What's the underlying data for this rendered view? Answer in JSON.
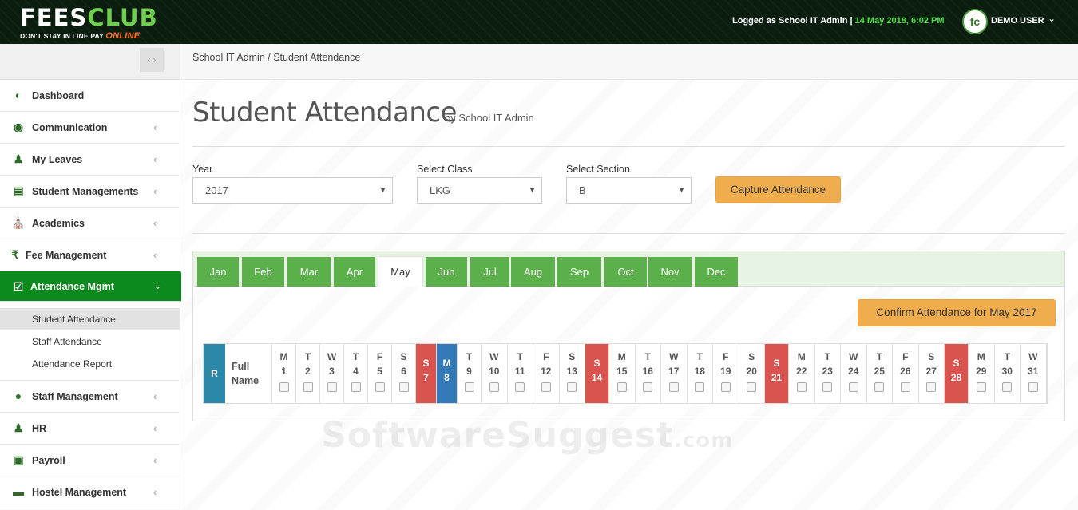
{
  "header": {
    "logo_fees": "FEES",
    "logo_club": "CLUB",
    "tagline": "DON'T STAY IN LINE PAY",
    "tagline_online": "ONLINE",
    "logged_as": "Logged as School IT Admin |",
    "datetime": "14 May 2018, 6:02 PM",
    "avatar_initials": "fc",
    "user_name": "DEMO USER"
  },
  "sidebar": {
    "items": [
      {
        "label": "Dashboard",
        "icon": "dashboard-icon"
      },
      {
        "label": "Communication",
        "icon": "comments-icon"
      },
      {
        "label": "My Leaves",
        "icon": "user-tree-icon"
      },
      {
        "label": "Student Managements",
        "icon": "id-card-icon"
      },
      {
        "label": "Academics",
        "icon": "institution-icon"
      },
      {
        "label": "Fee Management",
        "icon": "rupee-icon"
      },
      {
        "label": "Attendance Mgmt",
        "icon": "check-square-icon"
      },
      {
        "label": "Staff Management",
        "icon": "user-circle-icon"
      },
      {
        "label": "HR",
        "icon": "user-tree-icon"
      },
      {
        "label": "Payroll",
        "icon": "credit-card-icon"
      },
      {
        "label": "Hostel Management",
        "icon": "bed-icon"
      }
    ],
    "submenu": [
      "Student Attendance",
      "Staff Attendance",
      "Attendance Report"
    ]
  },
  "breadcrumb": "School IT Admin / Student Attendance",
  "page": {
    "title": "Student Attendance",
    "subtitle": "by School IT Admin"
  },
  "filters": {
    "year_label": "Year",
    "year_value": "2017",
    "class_label": "Select Class",
    "class_value": "LKG",
    "section_label": "Select Section",
    "section_value": "B",
    "capture_button": "Capture Attendance"
  },
  "months": [
    "Jan",
    "Feb",
    "Mar",
    "Apr",
    "May",
    "Jun",
    "Jul",
    "Aug",
    "Sep",
    "Oct",
    "Nov",
    "Dec"
  ],
  "active_month": "May",
  "confirm_button": "Confirm Attendance for May 2017",
  "grid": {
    "r_header": "R",
    "name_header_1": "Full",
    "name_header_2": "Name",
    "days": [
      {
        "d": "M",
        "n": "1"
      },
      {
        "d": "T",
        "n": "2"
      },
      {
        "d": "W",
        "n": "3"
      },
      {
        "d": "T",
        "n": "4"
      },
      {
        "d": "F",
        "n": "5"
      },
      {
        "d": "S",
        "n": "6"
      },
      {
        "d": "S",
        "n": "7",
        "kind": "sun"
      },
      {
        "d": "M",
        "n": "8",
        "kind": "today"
      },
      {
        "d": "T",
        "n": "9"
      },
      {
        "d": "W",
        "n": "10"
      },
      {
        "d": "T",
        "n": "11"
      },
      {
        "d": "F",
        "n": "12"
      },
      {
        "d": "S",
        "n": "13"
      },
      {
        "d": "S",
        "n": "14",
        "kind": "sun"
      },
      {
        "d": "M",
        "n": "15"
      },
      {
        "d": "T",
        "n": "16"
      },
      {
        "d": "W",
        "n": "17"
      },
      {
        "d": "T",
        "n": "18"
      },
      {
        "d": "F",
        "n": "19"
      },
      {
        "d": "S",
        "n": "20"
      },
      {
        "d": "S",
        "n": "21",
        "kind": "sun"
      },
      {
        "d": "M",
        "n": "22"
      },
      {
        "d": "T",
        "n": "23"
      },
      {
        "d": "W",
        "n": "24"
      },
      {
        "d": "T",
        "n": "25"
      },
      {
        "d": "F",
        "n": "26"
      },
      {
        "d": "S",
        "n": "27"
      },
      {
        "d": "S",
        "n": "28",
        "kind": "sun"
      },
      {
        "d": "M",
        "n": "29"
      },
      {
        "d": "T",
        "n": "30"
      },
      {
        "d": "W",
        "n": "31"
      }
    ]
  },
  "colors": {
    "brand_green": "#0d8a1e",
    "tab_green": "#5bb04c",
    "orange": "#f0ad4e",
    "sunday_red": "#d9534f",
    "today_blue": "#337ab7"
  }
}
